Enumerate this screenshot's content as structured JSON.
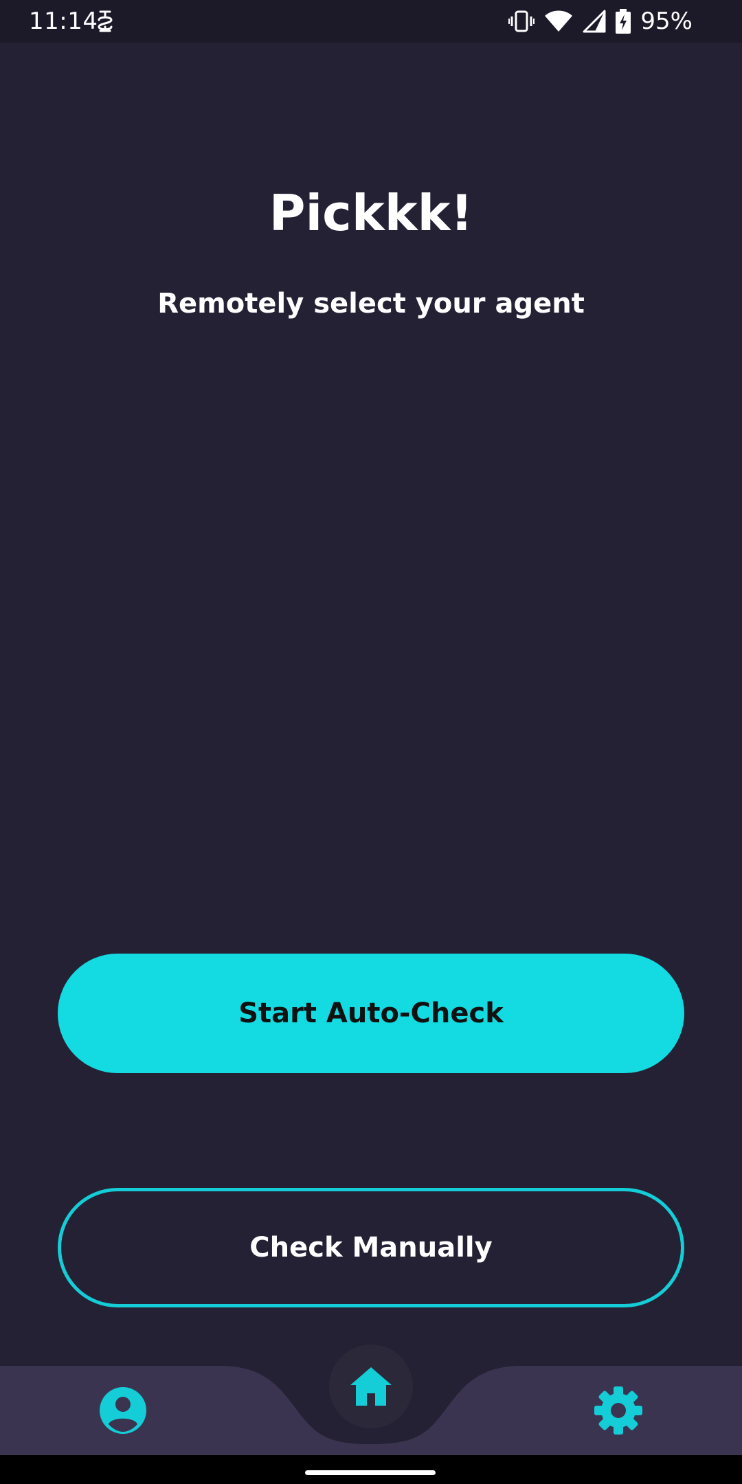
{
  "status_bar": {
    "time": "11:14",
    "battery_percent": "95%",
    "icons": [
      "app-notification-icon",
      "vibrate-icon",
      "wifi-icon",
      "cellular-signal-icon",
      "battery-charging-icon"
    ]
  },
  "header": {
    "title": "Pickkk!",
    "subtitle": "Remotely select your agent"
  },
  "actions": {
    "auto_check_label": "Start Auto-Check",
    "manual_check_label": "Check Manually"
  },
  "bottom_nav": {
    "items": [
      {
        "icon": "profile-icon"
      },
      {
        "icon": "home-icon",
        "active": true
      },
      {
        "icon": "settings-gear-icon"
      }
    ]
  },
  "colors": {
    "background": "#242134",
    "accent": "#14dbe1",
    "nav_background": "#3b3450",
    "text": "#ffffff"
  }
}
